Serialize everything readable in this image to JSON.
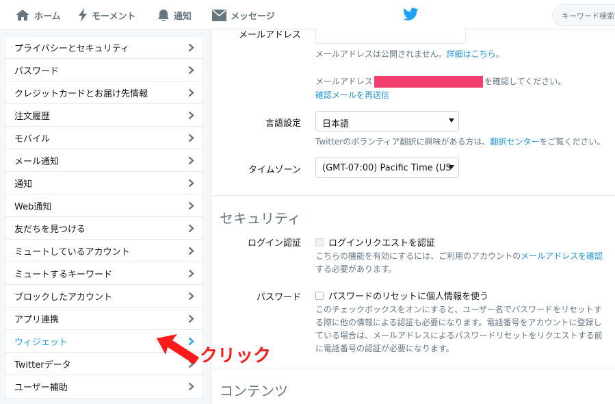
{
  "nav": {
    "home": "ホーム",
    "moments": "モーメント",
    "notifications": "通知",
    "messages": "メッセージ",
    "search_placeholder": "キーワード検索"
  },
  "sidebar": {
    "items": [
      {
        "label": "プライバシーとセキュリティ"
      },
      {
        "label": "パスワード"
      },
      {
        "label": "クレジットカードとお届け先情報"
      },
      {
        "label": "注文履歴"
      },
      {
        "label": "モバイル"
      },
      {
        "label": "メール通知"
      },
      {
        "label": "通知"
      },
      {
        "label": "Web通知"
      },
      {
        "label": "友だちを見つける"
      },
      {
        "label": "ミュートしているアカウント"
      },
      {
        "label": "ミュートするキーワード"
      },
      {
        "label": "ブロックしたアカウント"
      },
      {
        "label": "アプリ連携"
      },
      {
        "label": "ウィジェット"
      },
      {
        "label": "Twitterデータ"
      },
      {
        "label": "ユーザー補助"
      }
    ],
    "active_index": 13
  },
  "account": {
    "email_label": "メールアドレス",
    "email_note_prefix": "メールアドレスは公開されません。",
    "email_note_link": "詳細はこちら。",
    "confirm_prefix": "メールアドレス",
    "confirm_suffix": "を確認してください。",
    "resend_link": "確認メールを再送信",
    "language_label": "言語設定",
    "language_value": "日本語",
    "translate_prefix": "Twitterのボランティア翻訳に興味がある方は、",
    "translate_link": "翻訳センター",
    "translate_suffix": "をご覧ください。",
    "timezone_label": "タイムゾーン",
    "timezone_value": "(GMT-07:00) Pacific Time (US"
  },
  "security": {
    "title": "セキュリティ",
    "login_label": "ログイン認証",
    "login_check": "ログインリクエストを認証",
    "login_help_prefix": "こちらの機能を有効にするには、ご利用のアカウントの",
    "login_help_link": "メールアドレスを確認",
    "login_help_suffix": "する必要があります。",
    "password_label": "パスワード",
    "password_check": "パスワードのリセットに個人情報を使う",
    "password_help": [
      "このチェックボックスをオンにすると、ユーザー名でパスワードをリセットす",
      "る際に他の情報による認証も必要になります。電話番号をアカウントに登録し",
      "ている場合は、メールアドレスによるパスワードリセットをリクエストする前",
      "に電話番号の認証が必要になります。"
    ]
  },
  "content": {
    "title": "コンテンツ"
  },
  "annotation": {
    "text": "クリック"
  },
  "colors": {
    "accent": "#1da1f2",
    "link": "#1b95e0",
    "redaction": "#f43f6e",
    "annotation": "#ff1a1a"
  }
}
